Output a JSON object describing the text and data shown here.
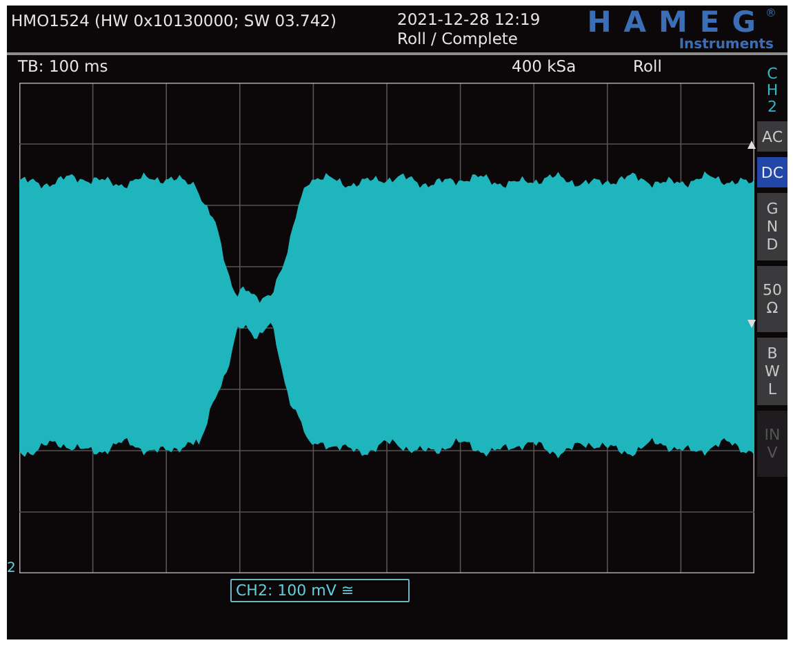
{
  "header": {
    "device": "HMO1524 (HW 0x10130000; SW 03.742)",
    "datetime": "2021-12-28 12:19",
    "mode": "Roll / Complete",
    "logo": {
      "name": "HAMEG",
      "mark": "®",
      "subtitle": "Instruments"
    }
  },
  "status": {
    "timebase": "TB: 100 ms",
    "sample_rate": "400 kSa",
    "acquisition": "Roll"
  },
  "side_menu": {
    "title": "CH2",
    "buttons": [
      {
        "label": "AC",
        "kind": "inline",
        "selected": false,
        "disabled": false
      },
      {
        "label": "DC",
        "kind": "inline",
        "selected": true,
        "disabled": false
      },
      {
        "label": "GND",
        "kind": "stacked",
        "selected": false,
        "disabled": false
      },
      {
        "label": "50 Ω",
        "kind": "stacked",
        "selected": false,
        "disabled": false
      },
      {
        "label": "BWL",
        "kind": "stacked",
        "selected": false,
        "disabled": false
      },
      {
        "label": "INV",
        "kind": "stacked",
        "selected": false,
        "disabled": true
      }
    ]
  },
  "screen": {
    "channel_marker": "2",
    "channel_label": "CH2: 100 mV ≅"
  }
}
